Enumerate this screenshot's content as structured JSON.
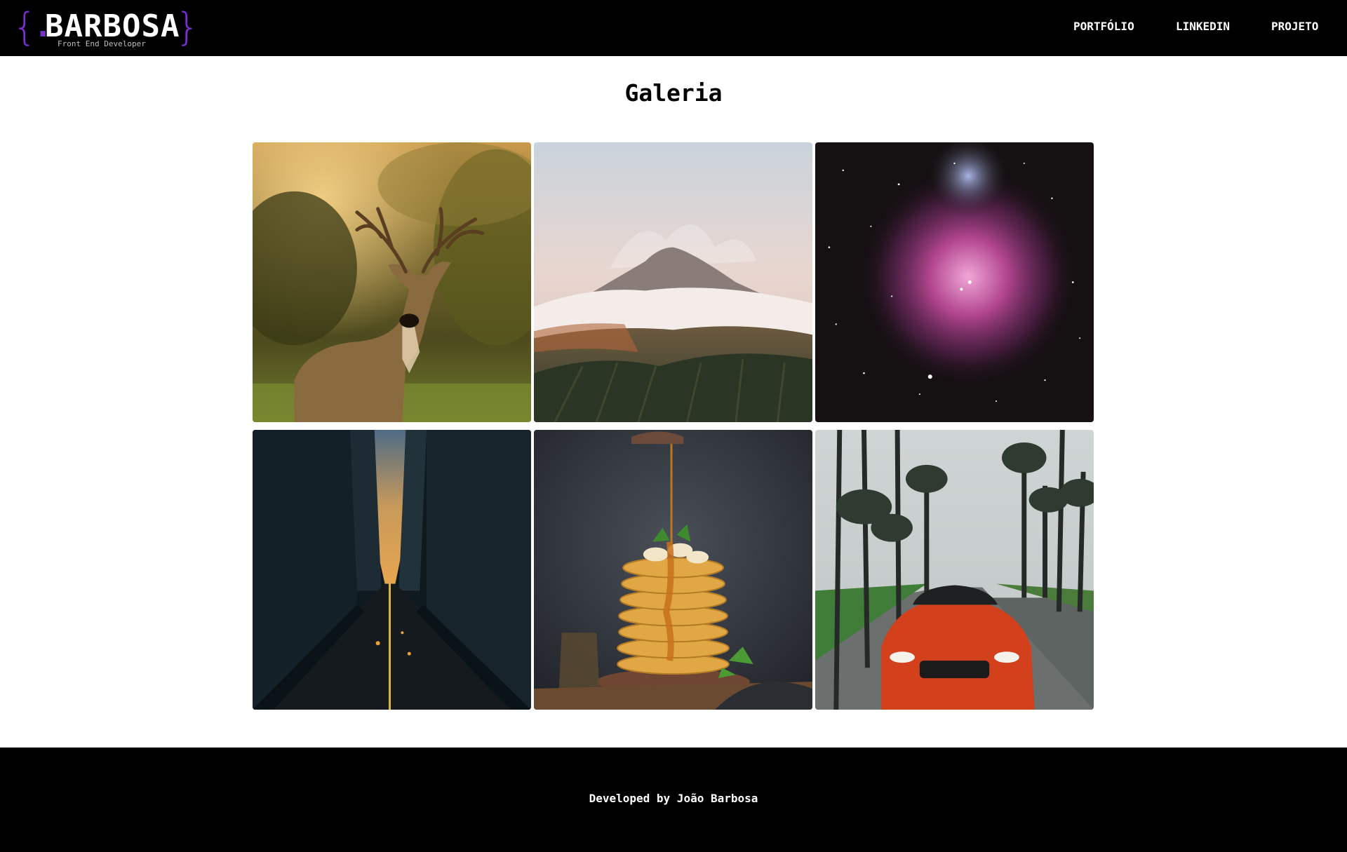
{
  "header": {
    "logo": {
      "brace_open": "{",
      "dot": ".",
      "name": "BARBOSA",
      "brace_close": "}",
      "subtitle": "Front End Developer",
      "accent_color": "#7b2fd0"
    },
    "nav": [
      {
        "label": "PORTFÓLIO"
      },
      {
        "label": "LINKEDIN"
      },
      {
        "label": "PROJETO"
      }
    ]
  },
  "main": {
    "title": "Galeria",
    "gallery": [
      {
        "subject": "deer-photo"
      },
      {
        "subject": "volcano-mountain-photo"
      },
      {
        "subject": "nebula-photo"
      },
      {
        "subject": "city-avenue-photo"
      },
      {
        "subject": "pancakes-photo"
      },
      {
        "subject": "red-car-palm-trees-photo"
      }
    ]
  },
  "footer": {
    "text": "Developed by João Barbosa"
  },
  "colors": {
    "header_bg": "#000000",
    "footer_bg": "#000000",
    "page_bg": "#ffffff",
    "text_light": "#ffffff",
    "accent": "#7b2fd0"
  }
}
